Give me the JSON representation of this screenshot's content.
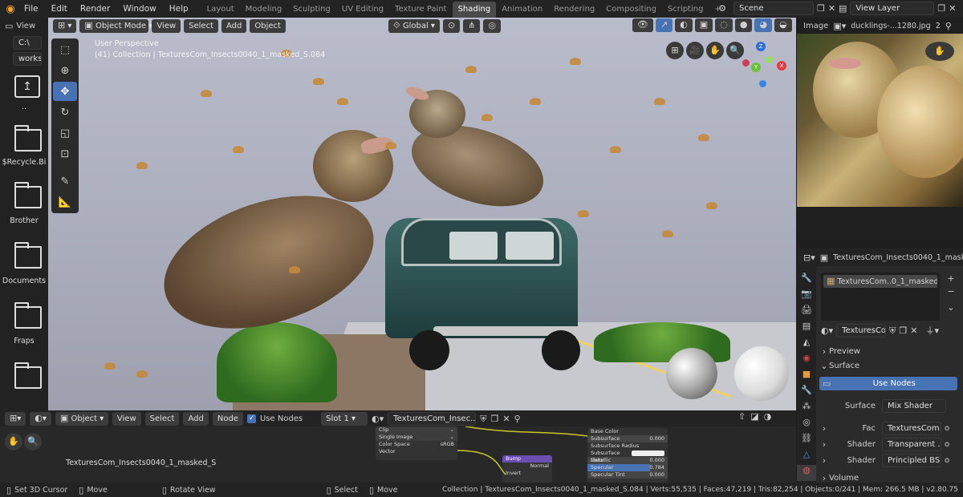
{
  "menu": [
    "File",
    "Edit",
    "Render",
    "Window",
    "Help"
  ],
  "workspaces": [
    "Layout",
    "Modeling",
    "Sculpting",
    "UV Editing",
    "Texture Paint",
    "Shading",
    "Animation",
    "Rendering",
    "Compositing",
    "Scripting"
  ],
  "active_workspace": "Shading",
  "add_workspace": "+",
  "scene": {
    "label": "Scene"
  },
  "view_layer": {
    "label": "View Layer"
  },
  "file_panel": {
    "header_label": "View",
    "path1": "C:\\",
    "path2": "works",
    "parent": "..",
    "items": [
      "$Recycle.Bi",
      "Brother",
      "Documents",
      "Fraps",
      ""
    ]
  },
  "viewport": {
    "mode": "Object Mode",
    "menus": [
      "View",
      "Select",
      "Add",
      "Object"
    ],
    "transform": "Global",
    "info_line1": "User Perspective",
    "info_line2": "(41) Collection | TexturesCom_Insects0040_1_masked_S.084",
    "gizmo": {
      "x": "X",
      "y": "Y",
      "z": "Z"
    }
  },
  "image_panel": {
    "label": "Image",
    "filename": "ducklings-...1280.jpg",
    "users": "2"
  },
  "properties": {
    "object_name": "TexturesCom_Insects0040_1_maske",
    "material_slot": "TexturesCom..0_1_masked_S",
    "material_field": "TexturesCom...",
    "preview": "Preview",
    "surface": "Surface",
    "use_nodes": "Use Nodes",
    "rows": [
      {
        "label": "Surface",
        "value": "Mix Shader"
      },
      {
        "label": "Fac",
        "value": "TexturesCom...",
        "dot": "o"
      },
      {
        "label": "Shader",
        "value": "Transparent ...",
        "dot": "o"
      },
      {
        "label": "Shader",
        "value": "Principled BS...",
        "dot": "o"
      }
    ],
    "volume": "Volume"
  },
  "node_editor": {
    "object": "Object",
    "menus": [
      "View",
      "Select",
      "Add",
      "Node"
    ],
    "use_nodes": "Use Nodes",
    "slot": "Slot 1",
    "material": "TexturesCom_Insec...",
    "material_label": "TexturesCom_Insects0040_1_masked_S",
    "image_node": [
      {
        "label": "Clip",
        "value": ""
      },
      {
        "label": "Single Image",
        "value": ""
      },
      {
        "label": "Color Space",
        "value": "sRGB"
      },
      {
        "label": "Vector",
        "value": ""
      }
    ],
    "bump_node": {
      "title": "Bump",
      "mode": "Normal",
      "input": "Invert"
    },
    "bsdf_node": [
      {
        "label": "Base Color",
        "value": ""
      },
      {
        "label": "Subsurface",
        "value": "0.000"
      },
      {
        "label": "Subsurface Radius",
        "value": ""
      },
      {
        "label": "Subsurface Color",
        "value": ""
      },
      {
        "label": "Metallic",
        "value": "0.000"
      },
      {
        "label": "Specular",
        "value": "0.784"
      },
      {
        "label": "Specular Tint",
        "value": "0.000"
      }
    ],
    "specular_fraction": 0.78
  },
  "status": {
    "left": [
      {
        "icon": "mouse-left-icon",
        "text": "Set 3D Cursor"
      },
      {
        "icon": "mouse-middle-icon",
        "text": "Move"
      },
      {
        "icon": "mouse-right-icon",
        "text": "Rotate View"
      },
      {
        "icon": "mouse-left-icon",
        "text": "Select"
      },
      {
        "icon": "mouse-middle-icon",
        "text": "Move"
      }
    ],
    "right": "Collection | TexturesCom_Insects0040_1_masked_S.084 | Verts:55,535 | Faces:47,219 | Tris:82,254 | Objects:0/241 | Mem: 266.5 MB | v2.80.75"
  }
}
